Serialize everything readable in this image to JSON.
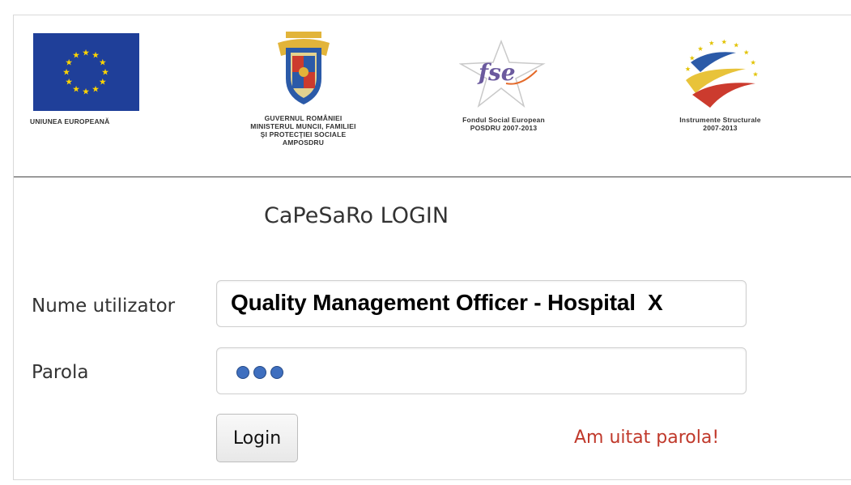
{
  "header": {
    "logos": [
      {
        "name": "eu",
        "caption_lines": [
          "UNIUNEA EUROPEANĂ"
        ]
      },
      {
        "name": "gov",
        "caption_lines": [
          "GUVERNUL ROMÂNIEI",
          "MINISTERUL MUNCII, FAMILIEI",
          "ŞI PROTECŢIEI SOCIALE",
          "AMPOSDRU"
        ]
      },
      {
        "name": "fse",
        "mark_text": "fse",
        "caption_lines": [
          "Fondul Social European",
          "POSDRU 2007-2013"
        ]
      },
      {
        "name": "is",
        "caption_lines": [
          "Instrumente Structurale",
          "2007-2013"
        ]
      }
    ]
  },
  "login": {
    "title": "CaPeSaRo LOGIN",
    "username_label": "Nume utilizator",
    "username_value": "Quality Management Officer - Hospital  X",
    "password_label": "Parola",
    "password_mask": "●●●",
    "login_button": "Login",
    "forgot_link": "Am uitat parola!"
  },
  "colors": {
    "eu_blue": "#1f3f99",
    "eu_star": "#ffd500",
    "link_red": "#c0392b",
    "password_dot": "#3f6fbf"
  }
}
